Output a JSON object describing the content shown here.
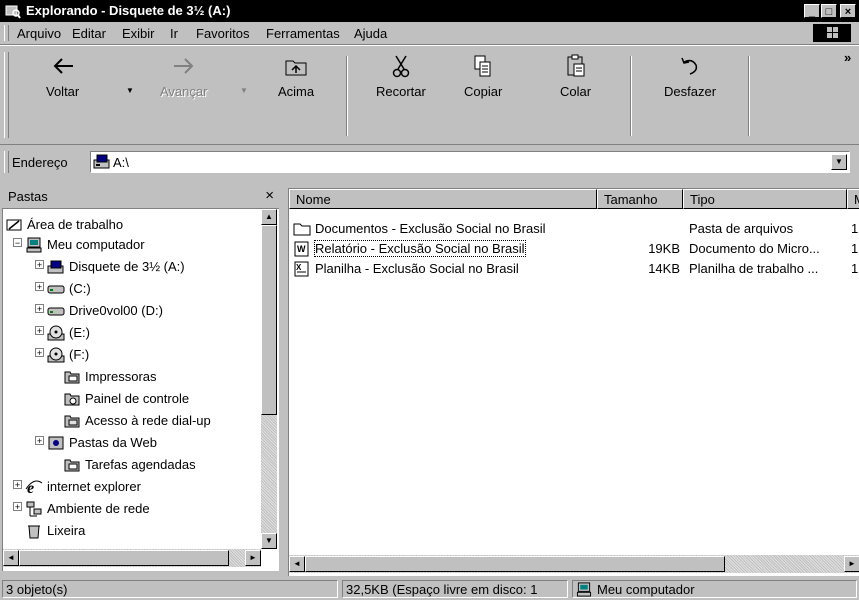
{
  "window": {
    "title": "Explorando - Disquete de 3½ (A:)",
    "controls": [
      "_",
      "□",
      "×"
    ]
  },
  "menu": {
    "items": [
      {
        "label": "Arquivo"
      },
      {
        "label": "Editar"
      },
      {
        "label": "Exibir"
      },
      {
        "label": "Ir"
      },
      {
        "label": "Favoritos"
      },
      {
        "label": "Ferramentas"
      },
      {
        "label": "Ajuda"
      }
    ]
  },
  "toolbar": {
    "back": "Voltar",
    "forward": "Avançar",
    "up": "Acima",
    "cut": "Recortar",
    "copy": "Copiar",
    "paste": "Colar",
    "undo": "Desfazer",
    "more": "»"
  },
  "address": {
    "label": "Endereço",
    "value": "A:\\"
  },
  "folders": {
    "title": "Pastas",
    "close": "×",
    "items": [
      {
        "label": "Área de trabalho",
        "icon": "desktop-icon"
      },
      {
        "label": "Meu computador",
        "icon": "computer-icon"
      },
      {
        "label": "Disquete de 3½ (A:)",
        "icon": "floppy-icon"
      },
      {
        "label": "(C:)",
        "icon": "drive-icon"
      },
      {
        "label": "Drive0vol00 (D:)",
        "icon": "drive-icon"
      },
      {
        "label": "(E:)",
        "icon": "cdrom-icon"
      },
      {
        "label": "(F:)",
        "icon": "cdrom-icon"
      },
      {
        "label": "Impressoras",
        "icon": "printers-icon"
      },
      {
        "label": "Painel de controle",
        "icon": "control-panel-icon"
      },
      {
        "label": "Acesso à rede dial-up",
        "icon": "dialup-icon"
      },
      {
        "label": "Pastas da Web",
        "icon": "web-folders-icon"
      },
      {
        "label": "Tarefas agendadas",
        "icon": "scheduled-tasks-icon"
      },
      {
        "label": "internet explorer",
        "icon": "ie-icon"
      },
      {
        "label": "Ambiente de rede",
        "icon": "network-icon"
      },
      {
        "label": "Lixeira",
        "icon": "recycle-bin-icon"
      }
    ]
  },
  "files": {
    "columns": [
      "Nome",
      "Tamanho",
      "Tipo",
      "M"
    ],
    "rows": [
      {
        "name": "Documentos - Exclusão Social no Brasil",
        "size": "",
        "type": "Pasta de arquivos",
        "mod": "1",
        "icon": "folder-icon"
      },
      {
        "name": "Relatório - Exclusão Social no Brasil",
        "size": "19KB",
        "type": "Documento do Micro...",
        "mod": "1",
        "icon": "word-doc-icon"
      },
      {
        "name": "Planilha - Exclusão Social no Brasil",
        "size": "14KB",
        "type": "Planilha de trabalho ...",
        "mod": "1",
        "icon": "excel-sheet-icon"
      }
    ]
  },
  "status": {
    "count": "3 objeto(s)",
    "space": "32,5KB (Espaço livre em disco: 1",
    "location": "Meu computador"
  }
}
